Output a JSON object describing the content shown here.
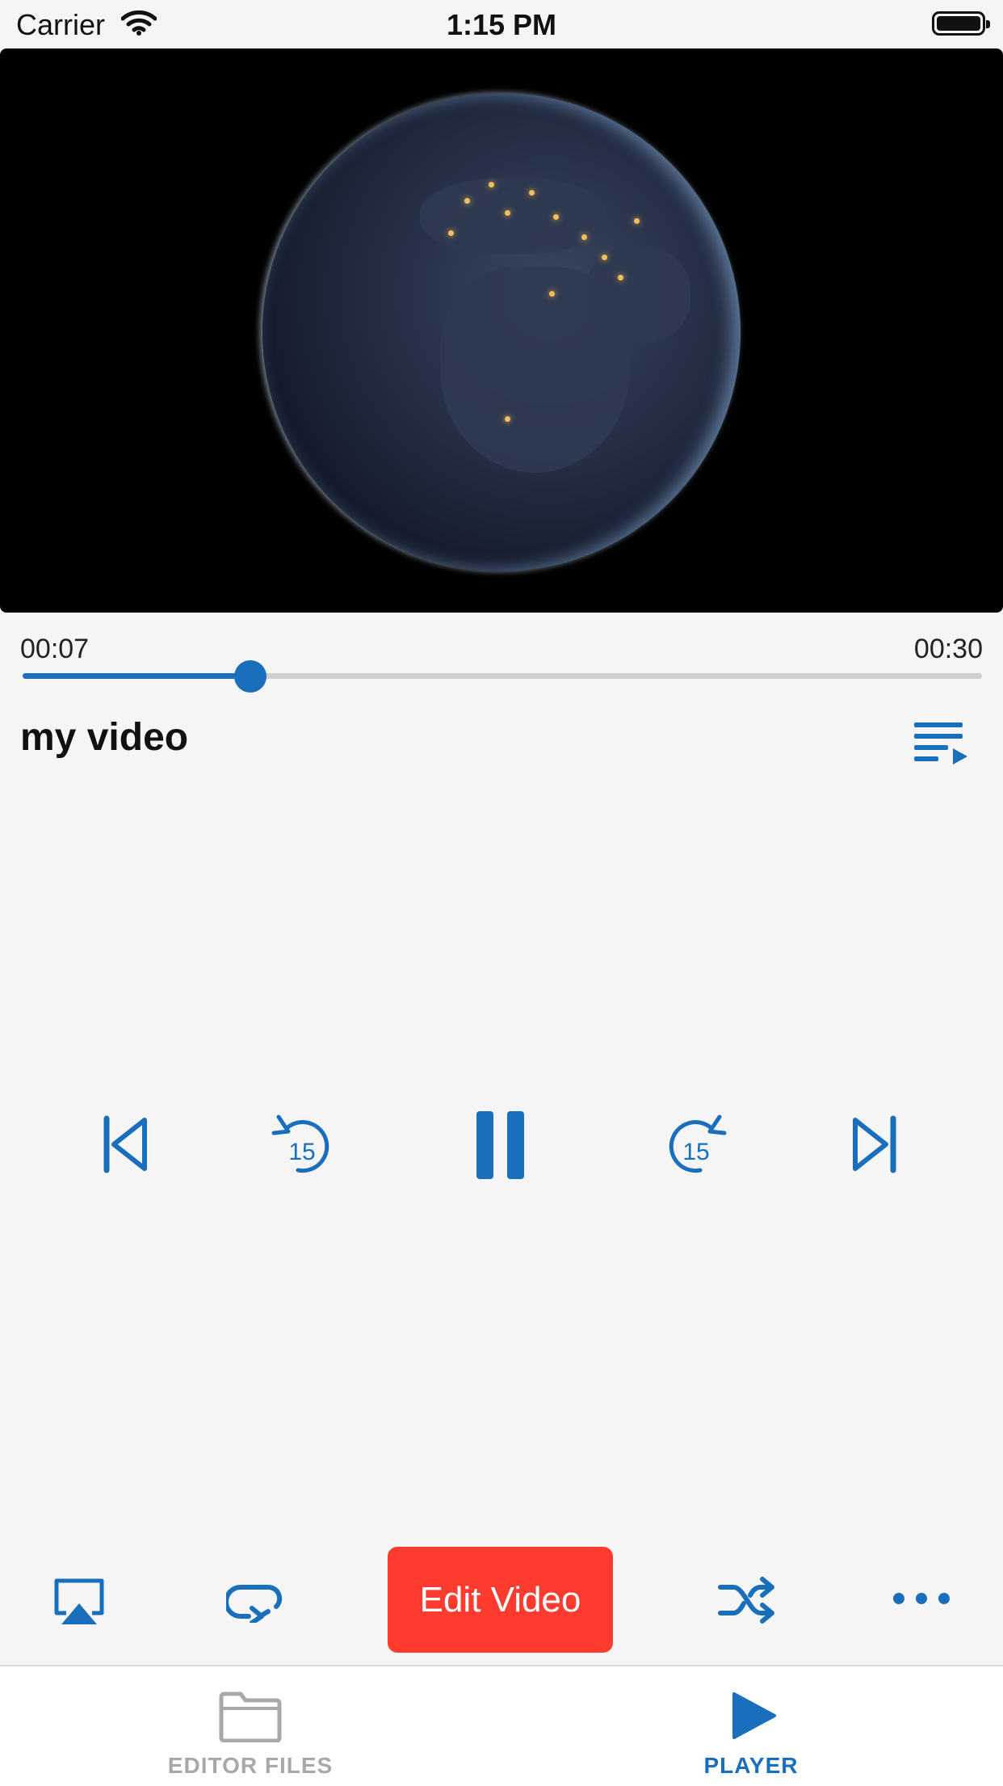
{
  "status_bar": {
    "carrier": "Carrier",
    "time": "1:15 PM"
  },
  "player": {
    "current_time": "00:07",
    "total_time": "00:30",
    "progress_fraction": 0.237,
    "title": "my video"
  },
  "actions": {
    "edit_label": "Edit Video"
  },
  "tabs": [
    {
      "label": "EDITOR FILES",
      "icon": "folder-icon",
      "active": false
    },
    {
      "label": "PLAYER",
      "icon": "play-icon",
      "active": true
    }
  ],
  "colors": {
    "accent": "#1a6fbd",
    "edit": "#ff3b30",
    "inactive": "#a8a8a8",
    "background": "#f5f5f5"
  }
}
